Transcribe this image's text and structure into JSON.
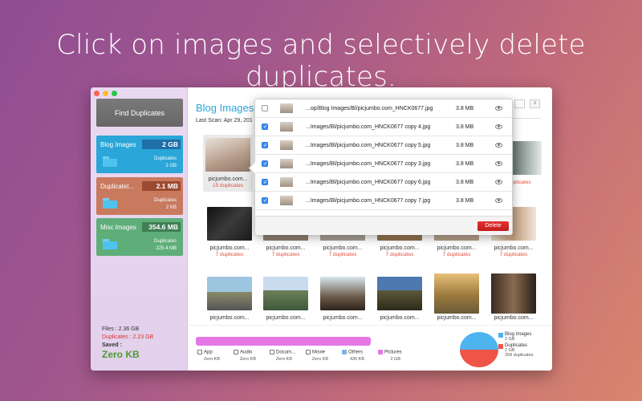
{
  "headline": "Click on images and selectively delete duplicates.",
  "colors": {
    "accent_blue": "#2aa6d8",
    "blog_cat": "#2aa6d8",
    "dup_cat": "#c97a5e",
    "misc_cat": "#5fae7a",
    "delete_red": "#d42424",
    "duplicates_text": "#d9342b",
    "saved_green": "#4a9b2e"
  },
  "sidebar": {
    "find_button": "Find Duplicates",
    "categories": [
      {
        "name": "Blog Images",
        "size": "2 GB",
        "dup_label": "Duplicates",
        "dup_size": "2 GB"
      },
      {
        "name": "Duplicatel...",
        "size": "2.1 MB",
        "dup_label": "Duplicates",
        "dup_size": "2 KB"
      },
      {
        "name": "Misc Images",
        "size": "354.6 MB",
        "dup_label": "Duplicates",
        "dup_size": "225.4 MB"
      }
    ],
    "stats": {
      "files": "Files : 2.36 GB",
      "duplicates": "Duplicates : 2.23 GB",
      "saved_label": "Saved :",
      "saved_value": "Zero KB"
    }
  },
  "main": {
    "title": "Blog Images",
    "last_scan": "Last Scan: Apr 29, 201",
    "thumbnails": [
      {
        "caption": "picjumbo.com...",
        "dup": "15 duplicates"
      },
      {
        "caption": "",
        "dup": "duplicates"
      },
      {
        "caption": "picjumbo.com...",
        "dup": "7 duplicates"
      },
      {
        "caption": "picjumbo.com...",
        "dup": "7 duplicates"
      },
      {
        "caption": "picjumbo.com...",
        "dup": "7 duplicates"
      },
      {
        "caption": "picjumbo.com...",
        "dup": "7 duplicates"
      },
      {
        "caption": "picjumbo.com...",
        "dup": "7 duplicates"
      },
      {
        "caption": "picjumbo.com...",
        "dup": "7 duplicates"
      },
      {
        "caption": "picjumbo.com...",
        "dup": ""
      },
      {
        "caption": "picjumbo.com...",
        "dup": ""
      },
      {
        "caption": "picjumbo.com...",
        "dup": ""
      },
      {
        "caption": "picjumbo.com...",
        "dup": ""
      },
      {
        "caption": "picjumbo.com...",
        "dup": ""
      },
      {
        "caption": "picjumbo.com...",
        "dup": ""
      }
    ]
  },
  "popup": {
    "rows": [
      {
        "checked": false,
        "file": "...op/Blog Images/Bl/picjumbo.com_HNCK0677.jpg",
        "size": "3.8 MB"
      },
      {
        "checked": true,
        "file": "...Images/Bl/picjumbo.com_HNCK0677 copy 4.jpg",
        "size": "3.8 MB"
      },
      {
        "checked": true,
        "file": "...Images/Bl/picjumbo.com_HNCK0677 copy 5.jpg",
        "size": "3.8 MB"
      },
      {
        "checked": true,
        "file": "...Images/Bl/picjumbo.com_HNCK0677 copy 3.jpg",
        "size": "3.8 MB"
      },
      {
        "checked": true,
        "file": "...Images/Bl/picjumbo.com_HNCK0677 copy 6.jpg",
        "size": "3.8 MB"
      },
      {
        "checked": true,
        "file": "...Images/Bl/picjumbo.com_HNCK0677 copy 7.jpg",
        "size": "3.8 MB"
      }
    ],
    "delete_label": "Delete"
  },
  "bottom": {
    "legend": [
      {
        "label": "App",
        "value": "Zero KB",
        "color": "#ffffff"
      },
      {
        "label": "Audio",
        "value": "Zero KB",
        "color": "#ffffff"
      },
      {
        "label": "Docum...",
        "value": "Zero KB",
        "color": "#ffffff"
      },
      {
        "label": "Movie",
        "value": "Zero KB",
        "color": "#ffffff"
      },
      {
        "label": "Others",
        "value": "430 KB",
        "color": "#7fb3e8"
      },
      {
        "label": "Pictures",
        "value": "2 GB",
        "color": "#e578e5"
      }
    ],
    "pie_legend": [
      {
        "label": "Blog Images",
        "value": "2 GB",
        "color": "#4db4f0"
      },
      {
        "label": "Duplicates",
        "value": "2 GB",
        "extra": "258 duplicates",
        "color": "#ee5546"
      }
    ]
  }
}
